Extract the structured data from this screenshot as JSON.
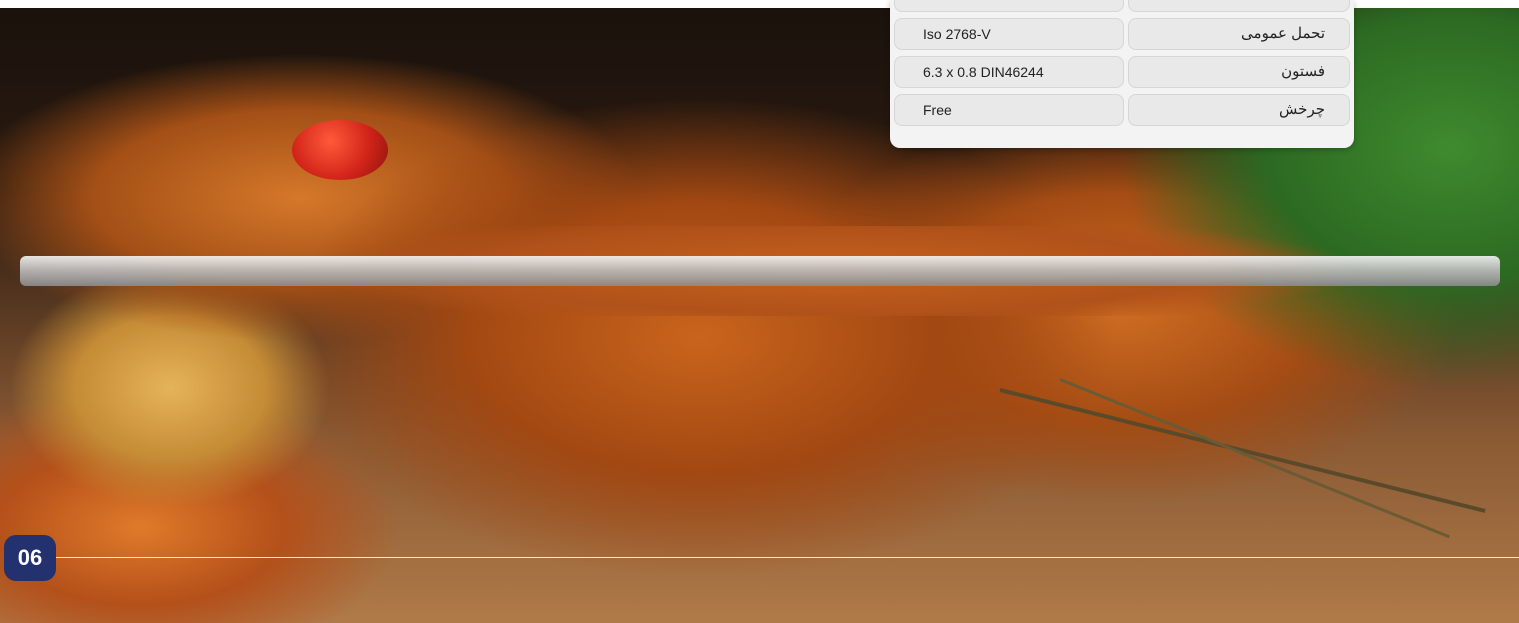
{
  "spec_table": {
    "rows": [
      {
        "label": "",
        "value": ""
      },
      {
        "label": "تحمل عمومی",
        "value": "Iso 2768-V"
      },
      {
        "label": "فستون",
        "value": "6.3 x 0.8 DIN46244"
      },
      {
        "label": "چرخش",
        "value": "Free"
      }
    ]
  },
  "page": {
    "number": "06",
    "badge_color": "#23316e"
  }
}
